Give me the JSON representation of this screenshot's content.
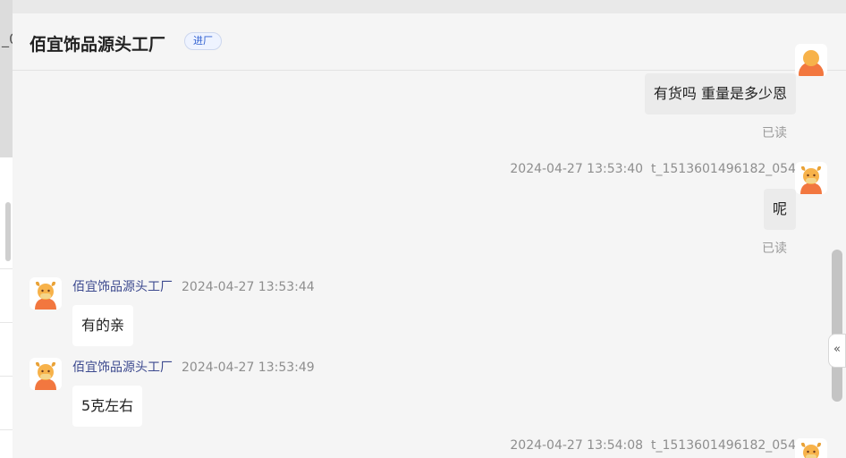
{
  "background_page": {
    "fragment_text": "_0"
  },
  "header": {
    "shop_name": "佰宜饰品源头工厂",
    "tag": "进厂"
  },
  "messages": [
    {
      "direction": "out",
      "text": "有货吗 重量是多少恩",
      "read_label": "已读"
    },
    {
      "direction": "out",
      "timestamp": "2024-04-27 13:53:40",
      "user_id": "t_1513601496182_054",
      "text": "呢",
      "read_label": "已读"
    },
    {
      "direction": "in",
      "sender": "佰宜饰品源头工厂",
      "timestamp": "2024-04-27 13:53:44",
      "text": "有的亲"
    },
    {
      "direction": "in",
      "sender": "佰宜饰品源头工厂",
      "timestamp": "2024-04-27 13:53:49",
      "text": "5克左右"
    },
    {
      "direction": "out",
      "timestamp": "2024-04-27 13:54:08",
      "user_id": "t_1513601496182_054"
    }
  ],
  "collapse_button": {
    "glyph": "«"
  },
  "icons": {
    "avatar": "cartoon-cow-avatar-icon",
    "collapse": "double-chevron-left-icon"
  },
  "colors": {
    "sender_name": "#3d4a8f",
    "tag_text": "#2f5fd0",
    "avatar_orange": "#f2773f"
  }
}
